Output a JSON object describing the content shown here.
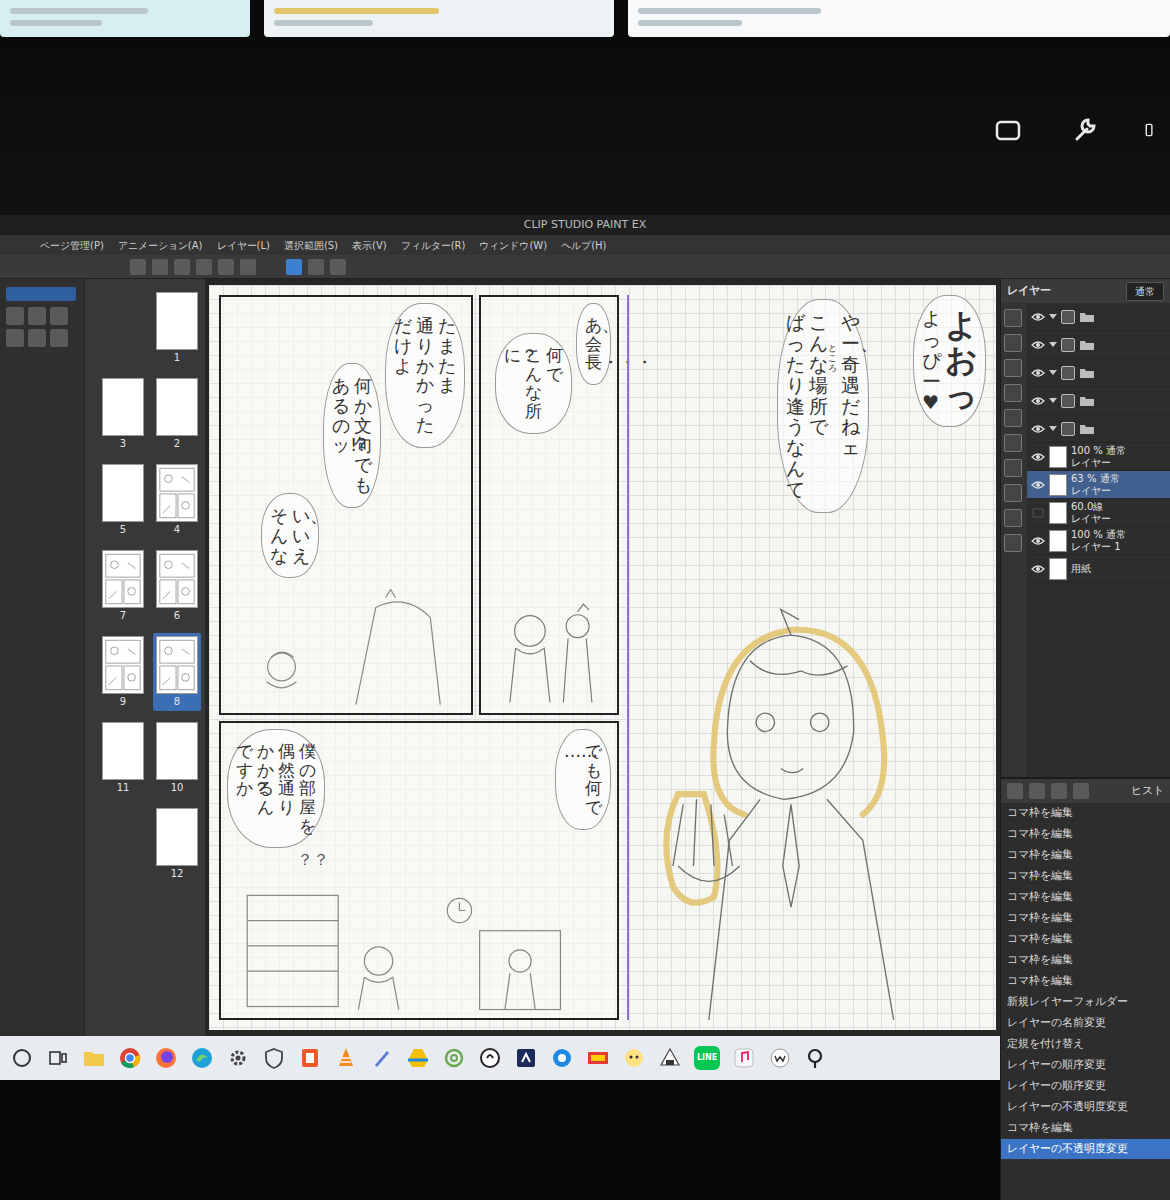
{
  "window": {
    "title": "CLIP STUDIO PAINT EX"
  },
  "menu": [
    "ページ管理(P)",
    "アニメーション(A)",
    "レイヤー(L)",
    "選択範囲(S)",
    "表示(V)",
    "フィルター(R)",
    "ウィンドウ(W)",
    "ヘルプ(H)"
  ],
  "pages": [
    {
      "label": "1",
      "selected": false,
      "drawn": false
    },
    {
      "label": "2",
      "selected": false,
      "drawn": false
    },
    {
      "label": "3",
      "selected": false,
      "drawn": false
    },
    {
      "label": "4",
      "selected": false,
      "drawn": true
    },
    {
      "label": "5",
      "selected": false,
      "drawn": false
    },
    {
      "label": "6",
      "selected": false,
      "drawn": true
    },
    {
      "label": "7",
      "selected": false,
      "drawn": true
    },
    {
      "label": "8",
      "selected": true,
      "drawn": true
    },
    {
      "label": "9",
      "selected": false,
      "drawn": true
    },
    {
      "label": "10",
      "selected": false,
      "drawn": false
    },
    {
      "label": "11",
      "selected": false,
      "drawn": false
    },
    {
      "label": "12",
      "selected": false,
      "drawn": false
    }
  ],
  "manga": {
    "panel_a": {
      "bubbles": [
        {
          "columns": [
            {
              "text": "たまたま",
              "kind": "normal"
            },
            {
              "text": "通りかかった",
              "kind": "normal"
            },
            {
              "text": "だけよ",
              "kind": "normal"
            }
          ]
        },
        {
          "columns": [
            {
              "text": "何か文句でも",
              "kind": "normal"
            },
            {
              "text": "あるのッ!?",
              "kind": "normal"
            }
          ]
        },
        {
          "columns": [
            {
              "text": "い、いえ",
              "kind": "normal"
            },
            {
              "text": "そんな",
              "kind": "normal"
            }
          ]
        }
      ],
      "notes": []
    },
    "panel_b": {
      "bubbles": [
        {
          "columns": [
            {
              "text": "あ、会長・・・",
              "kind": "normal"
            }
          ]
        },
        {
          "columns": [
            {
              "text": "何で",
              "kind": "normal"
            },
            {
              "text": "こんな所",
              "kind": "normal"
            },
            {
              "text": "に？",
              "kind": "normal"
            }
          ]
        }
      ],
      "notes": []
    },
    "panel_c": {
      "bubbles": [
        {
          "columns": [
            {
              "text": "でも何で",
              "kind": "normal"
            },
            {
              "text": "……",
              "kind": "normal"
            }
          ]
        },
        {
          "columns": [
            {
              "text": "僕の部屋を",
              "kind": "normal"
            },
            {
              "text": "偶然通り",
              "kind": "normal"
            },
            {
              "text": "かかるん",
              "kind": "normal"
            },
            {
              "text": "ですか？",
              "kind": "normal"
            }
          ]
        }
      ],
      "notes": [
        "？？"
      ]
    },
    "scene": {
      "bubbles": [
        {
          "columns": [
            {
              "text": "よおっ",
              "kind": "large"
            },
            {
              "text": "よっぴー♥",
              "kind": "normal"
            }
          ]
        },
        {
          "columns": [
            {
              "text": "やー、奇遇だねェ",
              "kind": "normal"
            },
            {
              "text": "こんな場所で",
              "kind": "normal",
              "ruby": "ところ"
            },
            {
              "text": "ばったり逢うなんて",
              "kind": "normal"
            }
          ]
        }
      ],
      "notes": []
    }
  },
  "layers": {
    "tab": "レイヤー",
    "blend": "通常",
    "items": [
      {
        "kind": "folder",
        "visible": true,
        "expanded": true,
        "selected": false
      },
      {
        "kind": "folder",
        "visible": true,
        "expanded": true,
        "selected": false
      },
      {
        "kind": "folder",
        "visible": true,
        "expanded": true,
        "selected": false
      },
      {
        "kind": "folder",
        "visible": true,
        "expanded": true,
        "selected": false
      },
      {
        "kind": "folder",
        "visible": true,
        "expanded": true,
        "selected": false
      },
      {
        "kind": "raster",
        "opacity": "100 % 通常",
        "name": "レイヤー",
        "visible": true,
        "selected": false
      },
      {
        "kind": "raster",
        "opacity": "63 % 通常",
        "name": "レイヤー",
        "visible": true,
        "selected": true
      },
      {
        "kind": "raster",
        "opacity": "60.0線",
        "name": "レイヤー",
        "visible": false,
        "selected": false
      },
      {
        "kind": "raster",
        "opacity": "100 % 通常",
        "name": "レイヤー 1",
        "visible": true,
        "selected": false
      },
      {
        "kind": "paper",
        "name": "用紙",
        "visible": true,
        "selected": false
      }
    ]
  },
  "history": {
    "tab": "ヒスト",
    "items": [
      {
        "label": "コマ枠を編集",
        "selected": false
      },
      {
        "label": "コマ枠を編集",
        "selected": false
      },
      {
        "label": "コマ枠を編集",
        "selected": false
      },
      {
        "label": "コマ枠を編集",
        "selected": false
      },
      {
        "label": "コマ枠を編集",
        "selected": false
      },
      {
        "label": "コマ枠を編集",
        "selected": false
      },
      {
        "label": "コマ枠を編集",
        "selected": false
      },
      {
        "label": "コマ枠を編集",
        "selected": false
      },
      {
        "label": "コマ枠を編集",
        "selected": false
      },
      {
        "label": "新規レイヤーフォルダー",
        "selected": false
      },
      {
        "label": "レイヤーの名前変更",
        "selected": false
      },
      {
        "label": "定規を付け替え",
        "selected": false
      },
      {
        "label": "レイヤーの順序変更",
        "selected": false
      },
      {
        "label": "レイヤーの順序変更",
        "selected": false
      },
      {
        "label": "レイヤーの不透明度変更",
        "selected": false
      },
      {
        "label": "コマ枠を編集",
        "selected": false
      },
      {
        "label": "レイヤーの不透明度変更",
        "selected": true
      }
    ]
  },
  "taskbar": {
    "line_label": "LINE"
  }
}
